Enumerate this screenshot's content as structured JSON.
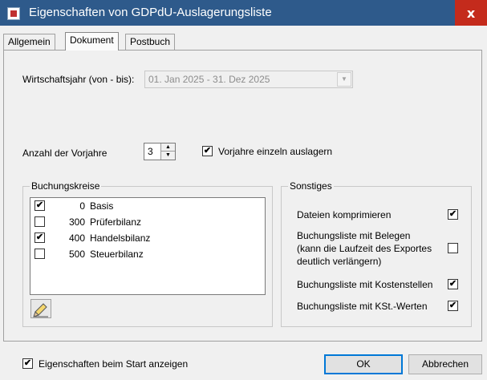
{
  "window": {
    "title": "Eigenschaften von GDPdU-Auslagerungsliste",
    "close_label": "x"
  },
  "tabs": [
    {
      "label": "Allgemein",
      "active": false
    },
    {
      "label": "Dokument",
      "active": true
    },
    {
      "label": "Postbuch",
      "active": false
    }
  ],
  "wirtschaftsjahr": {
    "label": "Wirtschaftsjahr (von - bis):",
    "value": "01. Jan 2025  -  31. Dez 2025"
  },
  "vorjahre": {
    "label": "Anzahl der Vorjahre",
    "value": "3",
    "checkbox_label": "Vorjahre einzeln auslagern",
    "checkbox_checked": true
  },
  "buchungskreise": {
    "title": "Buchungskreise",
    "items": [
      {
        "number": "0",
        "name": "Basis",
        "checked": true
      },
      {
        "number": "300",
        "name": "Prüferbilanz",
        "checked": false
      },
      {
        "number": "400",
        "name": "Handelsbilanz",
        "checked": true
      },
      {
        "number": "500",
        "name": "Steuerbilanz",
        "checked": false
      }
    ]
  },
  "sonstiges": {
    "title": "Sonstiges",
    "options": [
      {
        "label": "Dateien komprimieren",
        "checked": true
      },
      {
        "label": "Buchungsliste mit Belegen",
        "label2": "(kann die Laufzeit des Exportes",
        "label3": "deutlich verlängern)",
        "checked": false
      },
      {
        "label": "Buchungsliste mit Kostenstellen",
        "checked": true
      },
      {
        "label": "Buchungsliste mit KSt.-Werten",
        "checked": true
      }
    ]
  },
  "footer": {
    "show_on_start_label": "Eigenschaften beim Start anzeigen",
    "show_on_start_checked": true,
    "ok_label": "OK",
    "cancel_label": "Abbrechen"
  },
  "colors": {
    "titlebar": "#2e5a8b",
    "close": "#c42b1c"
  }
}
